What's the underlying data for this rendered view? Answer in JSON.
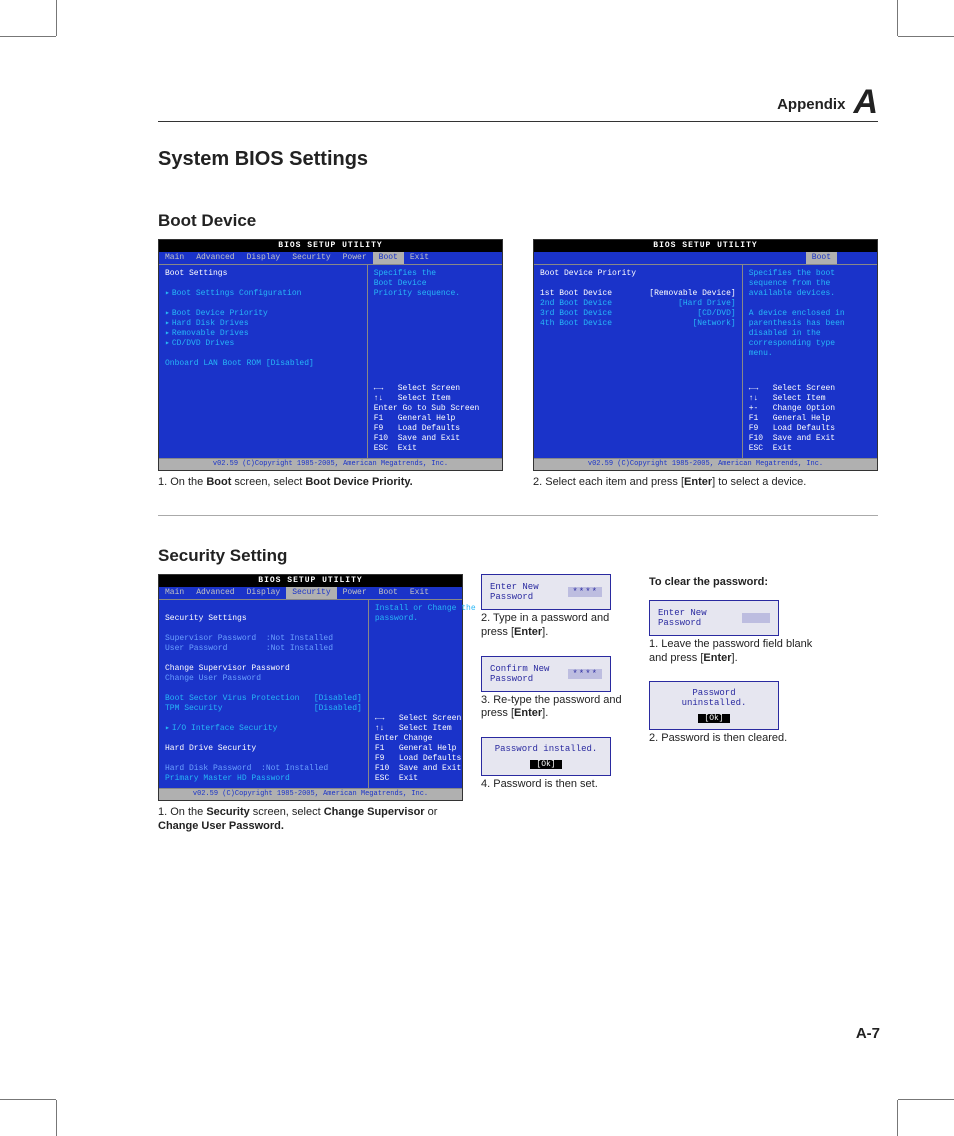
{
  "header": {
    "label": "Appendix",
    "letter": "A"
  },
  "title": "System BIOS Settings",
  "pagenum": "A-7",
  "bios_common": {
    "utility_title": "BIOS SETUP UTILITY",
    "copyright": "v02.59 (C)Copyright 1985-2005, American Megatrends, Inc."
  },
  "boot": {
    "heading": "Boot Device",
    "screen1": {
      "menus": [
        "Main",
        "Advanced",
        "Display",
        "Security",
        "Power",
        "Boot",
        "Exit"
      ],
      "active_menu": "Boot",
      "left_title": "Boot Settings",
      "items": [
        "Boot Settings Configuration",
        "",
        "Boot Device Priority",
        "Hard Disk Drives",
        "Removable Drives",
        "CD/DVD Drives"
      ],
      "extra": "Onboard LAN Boot ROM      [Disabled]",
      "help": "Specifies the\nBoot Device\nPriority sequence.",
      "hints": "←→   Select Screen\n↑↓   Select Item\nEnter Go to Sub Screen\nF1   General Help\nF9   Load Defaults\nF10  Save and Exit\nESC  Exit",
      "caption_pre": "1. On the ",
      "caption_b1": "Boot",
      "caption_mid": " screen, select ",
      "caption_b2": "Boot Device Priority."
    },
    "screen2": {
      "menus": [
        "Boot"
      ],
      "active_menu": "Boot",
      "left_title": "Boot Device Priority",
      "rows": [
        [
          "1st Boot Device",
          "[Removable Device]"
        ],
        [
          "2nd Boot Device",
          "[Hard Drive]"
        ],
        [
          "3rd Boot Device",
          "[CD/DVD]"
        ],
        [
          "4th Boot Device",
          "[Network]"
        ]
      ],
      "help": "Specifies the boot\nsequence from the\navailable devices.\n\nA device enclosed in\nparenthesis has been\ndisabled in the\ncorresponding type\nmenu.",
      "hints": "←→   Select Screen\n↑↓   Select Item\n+-   Change Option\nF1   General Help\nF9   Load Defaults\nF10  Save and Exit\nESC  Exit",
      "caption_pre": "2. Select each item and press [",
      "caption_b1": "Enter",
      "caption_post": "] to select a device."
    }
  },
  "security": {
    "heading": "Security Setting",
    "screen": {
      "menus": [
        "Main",
        "Advanced",
        "Display",
        "Security",
        "Power",
        "Boot",
        "Exit"
      ],
      "active_menu": "Security",
      "left_title": "Security Settings",
      "body": "Supervisor Password  :Not Installed\nUser Password        :Not Installed\n\nChange Supervisor Password\nChange User Password\n\nBoot Sector Virus Protection   [Disabled]\nTPM Security                   [Disabled]\n\n▸ I/O Interface Security\n\nHard Drive Security\n\nHard Disk Password  :Not Installed\nPrimary Master HD Password",
      "sel_line": "Change Supervisor Password",
      "help": "Install or Change the\npassword.",
      "hints": "←→   Select Screen\n↑↓   Select Item\nEnter Change\nF1   General Help\nF9   Load Defaults\nF10  Save and Exit\nESC  Exit",
      "caption_pre": "1. On the ",
      "caption_b1": "Security",
      "caption_mid": " screen, select ",
      "caption_b2": "Change Supervisor",
      "caption_mid2": " or ",
      "caption_b3": "Change User Password."
    },
    "mid": {
      "dlg1_label": "Enter New Password",
      "dlg1_stars": "****",
      "cap1_pre": "2. Type in a password and press [",
      "cap1_b": "Enter",
      "cap1_post": "].",
      "dlg2_label": "Confirm New Password",
      "dlg2_stars": "****",
      "cap2_pre": "3. Re-type the password and press [",
      "cap2_b": "Enter",
      "cap2_post": "].",
      "dlg3_label": "Password installed.",
      "ok": "[Ok]",
      "cap3": "4. Password is then set."
    },
    "right": {
      "heading": "To clear the password:",
      "dlg_label": "Enter New Password",
      "cap1_pre": "1. Leave the password field blank and press [",
      "cap1_b": "Enter",
      "cap1_post": "].",
      "dlg2_label": "Password uninstalled.",
      "ok": "[Ok]",
      "cap2": "2. Password is then cleared."
    }
  }
}
